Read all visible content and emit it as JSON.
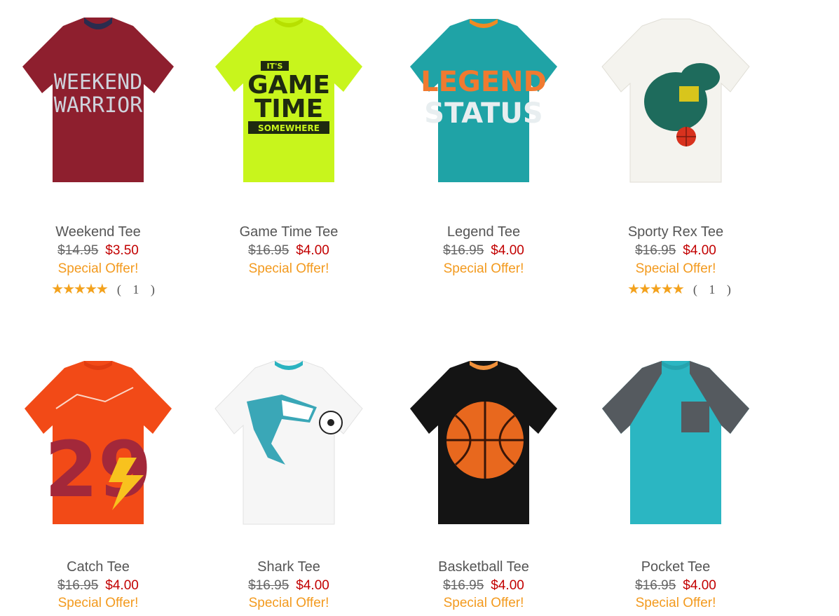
{
  "products": [
    {
      "name": "Weekend Tee",
      "old_price": "$14.95",
      "price": "$3.50",
      "offer": "Special Offer!",
      "rating": {
        "stars": "★★★★★",
        "count": "( 1 )"
      },
      "color": "#8e1f2e",
      "collar": "#2a2c4e",
      "graphic": [
        "WEEKEND",
        "WARRIOR"
      ],
      "graphic_color": "#cfd3dc",
      "icon": "weekend-warrior-tee-image"
    },
    {
      "name": "Game Time Tee",
      "old_price": "$16.95",
      "price": "$4.00",
      "offer": "Special Offer!",
      "color": "#c8f51c",
      "collar": "#b7e000",
      "graphic": [
        "IT'S",
        "GAME",
        "TIME",
        "SOMEWHERE"
      ],
      "graphic_color": "#1f2a10",
      "icon": "game-time-tee-image"
    },
    {
      "name": "Legend Tee",
      "old_price": "$16.95",
      "price": "$4.00",
      "offer": "Special Offer!",
      "color": "#1fa3a6",
      "collar": "#f08a22",
      "graphic": [
        "LEGEND",
        "STATUS"
      ],
      "graphic_color": "#f07a30",
      "icon": "legend-status-tee-image"
    },
    {
      "name": "Sporty Rex Tee",
      "old_price": "$16.95",
      "price": "$4.00",
      "offer": "Special Offer!",
      "rating": {
        "stars": "★★★★★",
        "count": "( 1 )"
      },
      "color": "#f4f3ee",
      "collar": "#e6e4dc",
      "graphic": [],
      "graphic_color": "#1e6b5c",
      "icon": "dinosaur-basketball-tee-image"
    },
    {
      "name": "Catch Tee",
      "old_price": "$16.95",
      "price": "$4.00",
      "offer": "Special Offer!",
      "color": "#f24a17",
      "collar": "#e03c10",
      "graphic": [
        "29"
      ],
      "graphic_color": "#a3283a",
      "icon": "football-catch-tee-image"
    },
    {
      "name": "Shark Tee",
      "old_price": "$16.95",
      "price": "$4.00",
      "offer": "Special Offer!",
      "color": "#f6f6f6",
      "collar": "#2bb3c0",
      "graphic": [],
      "graphic_color": "#3aa7b7",
      "icon": "shark-soccer-tee-image"
    },
    {
      "name": "Basketball Tee",
      "old_price": "$16.95",
      "price": "$4.00",
      "offer": "Special Offer!",
      "color": "#141414",
      "collar": "#f0903a",
      "graphic": [],
      "graphic_color": "#e8681e",
      "icon": "basketball-tee-image"
    },
    {
      "name": "Pocket Tee",
      "old_price": "$16.95",
      "price": "$4.00",
      "offer": "Special Offer!",
      "color": "#2bb6c2",
      "collar": "#25a3ae",
      "sleeve_color": "#555a5f",
      "graphic": [],
      "graphic_color": "#555a5f",
      "icon": "pocket-tee-image"
    }
  ]
}
